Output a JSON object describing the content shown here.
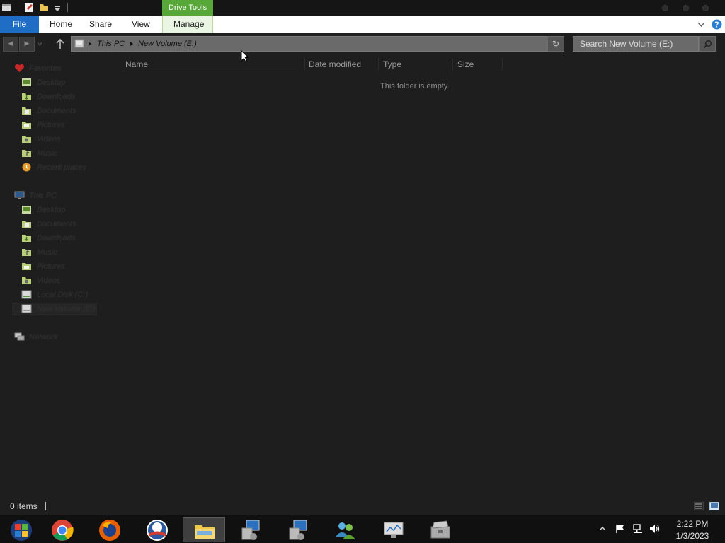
{
  "titlebar": {
    "context_tab": "Drive Tools",
    "quick_access_icons": [
      "properties-icon",
      "folder-icon",
      "customize-dropdown-icon"
    ]
  },
  "ribbon": {
    "tabs": [
      {
        "label": "File"
      },
      {
        "label": "Home"
      },
      {
        "label": "Share"
      },
      {
        "label": "View"
      },
      {
        "label": "Manage"
      }
    ]
  },
  "address": {
    "breadcrumbs": [
      "This PC",
      "New Volume (E:)"
    ],
    "search_placeholder": "Search New Volume (E:)"
  },
  "navpane": {
    "favorites": {
      "label": "Favorites",
      "items": [
        "Desktop",
        "Downloads",
        "Documents",
        "Pictures",
        "Videos",
        "Music",
        "Recent places"
      ]
    },
    "this_pc": {
      "label": "This PC",
      "items": [
        "Desktop",
        "Documents",
        "Downloads",
        "Music",
        "Pictures",
        "Videos",
        "Local Disk (C:)",
        "New Volume (E:)"
      ]
    },
    "network": {
      "label": "Network"
    },
    "selected": "New Volume (E:)"
  },
  "columns": [
    "Name",
    "Date modified",
    "Type",
    "Size"
  ],
  "empty_message": "This folder is empty.",
  "status": {
    "items": "0 items"
  },
  "taskbar": {
    "apps": [
      "start-orb",
      "chrome",
      "firefox",
      "obama-logo-app",
      "file-explorer",
      "network-setup",
      "network-setup-2",
      "users-app",
      "monitor-app",
      "toolbox-app"
    ],
    "active": "file-explorer"
  },
  "clock": {
    "time": "2:22 PM",
    "date": "1/3/2023"
  },
  "colors": {
    "file_tab": "#1f6dc5",
    "drive_tools": "#58a839",
    "background": "#1e1e1e"
  }
}
